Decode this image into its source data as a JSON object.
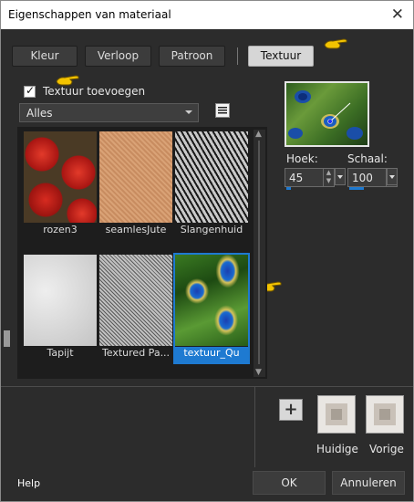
{
  "window": {
    "title": "Eigenschappen van materiaal"
  },
  "tabs": [
    {
      "label": "Kleur"
    },
    {
      "label": "Verloop"
    },
    {
      "label": "Patroon"
    },
    {
      "label": "Textuur",
      "active": true
    }
  ],
  "texture": {
    "add_label": "Textuur toevoegen",
    "checked": true,
    "category": "Alles"
  },
  "items": [
    {
      "label": "rozen3"
    },
    {
      "label": "seamlesJute"
    },
    {
      "label": "Slangenhuid"
    },
    {
      "label": "Tapijt"
    },
    {
      "label": "Textured Pa..."
    },
    {
      "label": "textuur_Qu",
      "selected": true
    }
  ],
  "params": {
    "angle_label": "Hoek:",
    "angle_value": "45",
    "angle_fill": 0.125,
    "scale_label": "Schaal:",
    "scale_value": "100",
    "scale_fill": 0.4
  },
  "swatches": {
    "current_label": "Huidige",
    "previous_label": "Vorige"
  },
  "footer": {
    "help": "Help",
    "ok": "OK",
    "cancel": "Annuleren"
  },
  "colors": {
    "accent": "#1e7ad1",
    "bg": "#2c2c2c"
  }
}
